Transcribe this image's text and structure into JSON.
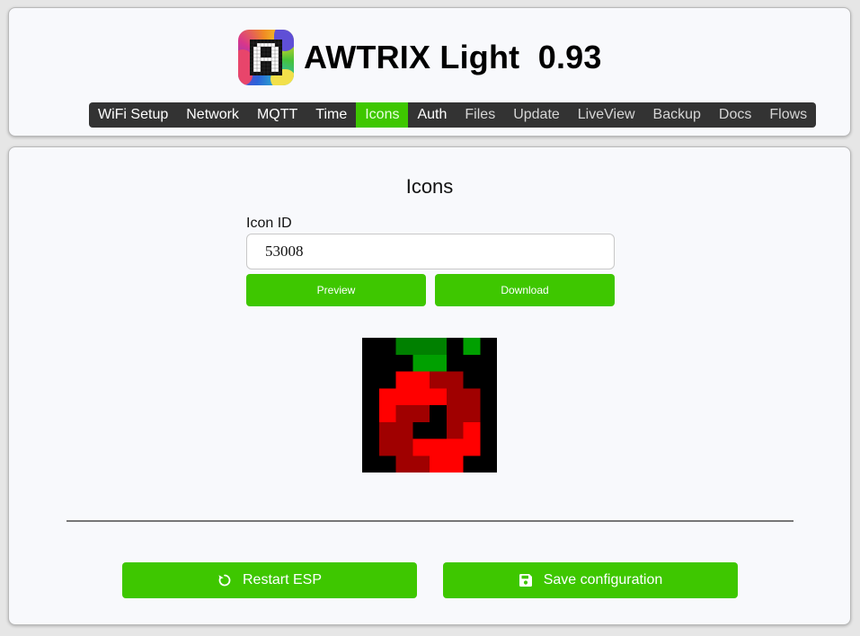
{
  "header": {
    "title": "AWTRIX Light  0.93"
  },
  "nav": {
    "items": [
      {
        "label": "WiFi Setup",
        "state": "normal"
      },
      {
        "label": "Network",
        "state": "normal"
      },
      {
        "label": "MQTT",
        "state": "normal"
      },
      {
        "label": "Time",
        "state": "normal"
      },
      {
        "label": "Icons",
        "state": "active"
      },
      {
        "label": "Auth",
        "state": "normal"
      },
      {
        "label": "Files",
        "state": "dim"
      },
      {
        "label": "Update",
        "state": "dim"
      },
      {
        "label": "LiveView",
        "state": "dim"
      },
      {
        "label": "Backup",
        "state": "dim"
      },
      {
        "label": "Docs",
        "state": "dim"
      },
      {
        "label": "Flows",
        "state": "dim"
      }
    ]
  },
  "main": {
    "section_title": "Icons",
    "icon_id_label": "Icon ID",
    "icon_id_value": "53008",
    "preview_label": "Preview",
    "download_label": "Download",
    "restart_label": "Restart ESP",
    "save_label": "Save configuration"
  },
  "icons": {
    "restart": "restart-icon",
    "save": "floppy-disk-icon"
  },
  "colors": {
    "accent": "#3ec700",
    "navbar_bg": "#333333",
    "card_bg": "#f8f9fc"
  },
  "icon_pixels": {
    "palette": {
      "k": "#000000",
      "g": "#008000",
      "G": "#00a000",
      "r": "#ff0000",
      "d": "#a00000"
    },
    "rows": [
      "kkgggkGk",
      "kkkGGkkk",
      "kkrrddkk",
      "krrrrddk",
      "krddkddk",
      "kddkkdrk",
      "kddrrrrk",
      "kkddrrkk"
    ]
  }
}
